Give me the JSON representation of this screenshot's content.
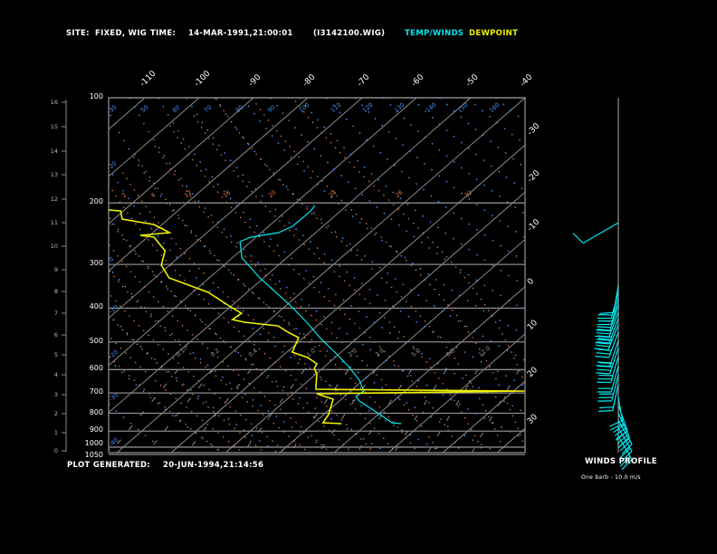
{
  "header": {
    "site_label": "SITE:",
    "site_value": "FIXED, WIG",
    "time_label": "TIME:",
    "time_value": "14-MAR-1991,21:00:01",
    "file": "(I3142100.WIG)",
    "legend_temp": "TEMP/WINDS",
    "legend_dew": "DEWPOINT"
  },
  "footer": {
    "generated_label": "PLOT GENERATED:",
    "generated_value": "20-JUN-1994,21:14:56"
  },
  "winds_panel": {
    "title": "WINDS PROFILE",
    "note": "One barb - 10.0 m/s"
  },
  "colors": {
    "temperature": "#00e8f0",
    "dewpoint": "#f0f000",
    "grid": "#8a8a8a",
    "dry_adiabat": "#4a90ff",
    "moist_adiabat": "#e07a50"
  },
  "chart_data": {
    "type": "line",
    "title": "Skew-T log-P sounding",
    "pressure_axis": {
      "ticks": [
        "100",
        "200",
        "300",
        "400",
        "500",
        "600",
        "700",
        "800",
        "900",
        "1000",
        "1050"
      ],
      "range": [
        1050,
        100
      ]
    },
    "height_axis_km": [
      "0",
      "1",
      "2",
      "3",
      "4",
      "5",
      "6",
      "7",
      "8",
      "9",
      "10",
      "11",
      "12",
      "13",
      "14",
      "15",
      "16"
    ],
    "isotherm_labels_top": [
      "-110",
      "-100",
      "-90",
      "-80",
      "-70",
      "-60",
      "-50",
      "-40"
    ],
    "isotherm_labels_right": [
      "-30",
      "-20",
      "-10",
      "0",
      "10",
      "20",
      "30"
    ],
    "dry_adiabat_labels": [
      "30",
      "50",
      "60",
      "70",
      "80",
      "90",
      "100",
      "110",
      "120",
      "130",
      "140",
      "150",
      "160"
    ],
    "dry_adiabat_labels_left": [
      "20",
      "0",
      "-10",
      "-20",
      "-30",
      "-40"
    ],
    "moist_labels": [
      "2",
      "4",
      "12",
      "16",
      "20",
      "24",
      "28",
      "32"
    ],
    "mixing_ratio_labels": [
      "0.1",
      "0.2",
      "0.4",
      "1.0",
      "2.0",
      "3.0",
      "5.0",
      "8.0",
      "12.0"
    ],
    "series": [
      {
        "name": "TEMP/WINDS",
        "points": [
          [
            203.4,
            -55.9
          ],
          [
            210.8,
            -55.5
          ],
          [
            233.3,
            -55.6
          ],
          [
            243.3,
            -56.8
          ],
          [
            250.7,
            -61.0
          ],
          [
            258.3,
            -62.0
          ],
          [
            287.5,
            -58.2
          ],
          [
            327.8,
            -50.7
          ],
          [
            392.1,
            -39.4
          ],
          [
            441.8,
            -32.3
          ],
          [
            486.0,
            -27.0
          ],
          [
            544.5,
            -20.1
          ],
          [
            595.3,
            -14.9
          ],
          [
            643.5,
            -10.7
          ],
          [
            691.0,
            -7.6
          ],
          [
            716.4,
            -7.9
          ],
          [
            738.0,
            -6.3
          ],
          [
            807.0,
            0.4
          ],
          [
            851.6,
            4.3
          ],
          [
            856.8,
            6.2
          ]
        ]
      },
      {
        "name": "DEWPOINT",
        "points": [
          [
            209.6,
            -92.9
          ],
          [
            210.8,
            -90.5
          ],
          [
            222.5,
            -88.5
          ],
          [
            230.5,
            -81.5
          ],
          [
            243.3,
            -76.9
          ],
          [
            247.7,
            -81.7
          ],
          [
            250.7,
            -78.8
          ],
          [
            274.1,
            -73.9
          ],
          [
            301.6,
            -71.5
          ],
          [
            327.8,
            -67.4
          ],
          [
            350.0,
            -60.3
          ],
          [
            360.7,
            -57.1
          ],
          [
            394.4,
            -50.4
          ],
          [
            413.7,
            -46.6
          ],
          [
            431.5,
            -46.9
          ],
          [
            439.2,
            -44.1
          ],
          [
            449.8,
            -37.2
          ],
          [
            471.8,
            -33.5
          ],
          [
            486.0,
            -30.9
          ],
          [
            534.8,
            -29.0
          ],
          [
            554.1,
            -25.0
          ],
          [
            577.7,
            -22.0
          ],
          [
            595.3,
            -21.5
          ],
          [
            617.0,
            -19.9
          ],
          [
            682.9,
            -16.8
          ],
          [
            691.0,
            22.0
          ],
          [
            691.0,
            22.0
          ],
          [
            703.5,
            -15.7
          ],
          [
            729.3,
            -11.5
          ],
          [
            807.0,
            -9.1
          ],
          [
            851.6,
            -8.4
          ],
          [
            856.8,
            -4.8
          ]
        ]
      }
    ],
    "winds": [
      {
        "p": 228,
        "dir": 240,
        "spd": 10
      },
      {
        "p": 345,
        "dir": 190,
        "spd": 10
      },
      {
        "p": 360,
        "dir": 195,
        "spd": 20
      },
      {
        "p": 375,
        "dir": 195,
        "spd": 20
      },
      {
        "p": 392,
        "dir": 198,
        "spd": 20
      },
      {
        "p": 410,
        "dir": 200,
        "spd": 30
      },
      {
        "p": 428,
        "dir": 200,
        "spd": 30
      },
      {
        "p": 447,
        "dir": 202,
        "spd": 40
      },
      {
        "p": 468,
        "dir": 200,
        "spd": 30
      },
      {
        "p": 495,
        "dir": 198,
        "spd": 20
      },
      {
        "p": 520,
        "dir": 198,
        "spd": 40
      },
      {
        "p": 550,
        "dir": 196,
        "spd": 30
      },
      {
        "p": 585,
        "dir": 195,
        "spd": 20
      },
      {
        "p": 620,
        "dir": 194,
        "spd": 30
      },
      {
        "p": 660,
        "dir": 192,
        "spd": 20
      },
      {
        "p": 720,
        "dir": 170,
        "spd": 20
      },
      {
        "p": 760,
        "dir": 160,
        "spd": 30
      },
      {
        "p": 800,
        "dir": 155,
        "spd": 30
      },
      {
        "p": 840,
        "dir": 150,
        "spd": 30
      },
      {
        "p": 880,
        "dir": 150,
        "spd": 20
      },
      {
        "p": 930,
        "dir": 150,
        "spd": 20
      }
    ]
  }
}
